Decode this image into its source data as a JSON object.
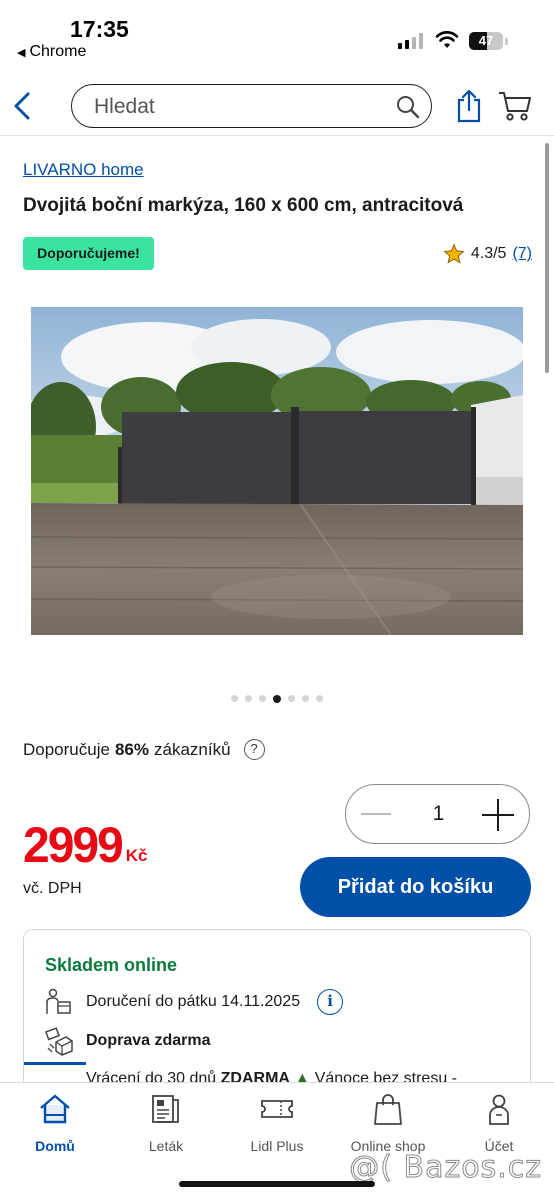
{
  "status_bar": {
    "time": "17:35",
    "back_app": "Chrome",
    "battery": "47"
  },
  "nav": {
    "search_placeholder": "Hledat"
  },
  "product": {
    "brand": "LIVARNO home",
    "title": "Dvojitá boční markýza, 160 x 600 cm, antracitová",
    "badge": "Doporučujeme!",
    "rating": "4.3/5",
    "rating_count": "(7)",
    "image_alt": "Dvojitá boční markýza na terase",
    "gallery": {
      "count": 7,
      "active_index": 3
    },
    "recommend": {
      "prefix": "Doporučuje",
      "percent": "86%",
      "suffix": "zákazníků",
      "help": "?"
    },
    "quantity": "1",
    "price": "2999",
    "currency": "Kč",
    "vat_note": "vč. DPH",
    "add_to_cart": "Přidat do košíku"
  },
  "stock": {
    "title": "Skladem online",
    "delivery": "Doručení do pátku 14.11.2025",
    "shipping": "Doprava zdarma",
    "returns_prefix": "Vrácení do 30 dnů",
    "returns_free": "ZDARMA",
    "returns_suffix": "Vánoce bez stresu -",
    "info_icon": "i"
  },
  "tabs": [
    {
      "label": "Domů",
      "icon": "home-icon",
      "active": true
    },
    {
      "label": "Leták",
      "icon": "leaflet-icon",
      "active": false
    },
    {
      "label": "Lidl Plus",
      "icon": "coupon-icon",
      "active": false
    },
    {
      "label": "Online shop",
      "icon": "shopping-bag-icon",
      "active": false
    },
    {
      "label": "Účet",
      "icon": "account-icon",
      "active": false
    }
  ],
  "watermark": "@( Bazos.cz",
  "colors": {
    "lidl_blue": "#0050aa",
    "price_red": "#e60a14",
    "badge_green": "#3be3a0",
    "stock_green": "#0b7a3e"
  }
}
